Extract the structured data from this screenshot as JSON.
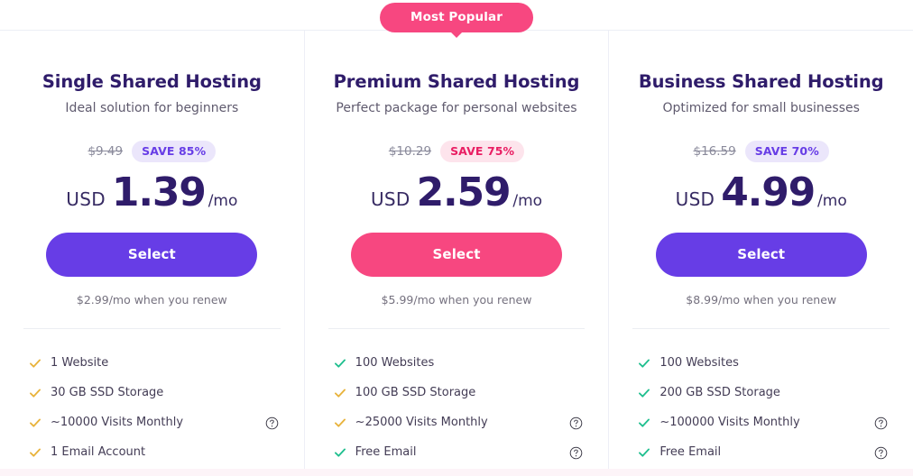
{
  "badge": {
    "most_popular": "Most Popular"
  },
  "colors": {
    "purple": "#673de6",
    "pink": "#f74780",
    "heading": "#2f1c6a",
    "check_green": "#20bf8f",
    "check_amber": "#e8b33c"
  },
  "plans": [
    {
      "id": "single-shared-hosting",
      "title": "Single Shared Hosting",
      "subtitle": "Ideal solution for beginners",
      "old_price": "$9.49",
      "save_label": "SAVE 85%",
      "save_style": "purple",
      "currency": "USD",
      "amount": "1.39",
      "period": "/mo",
      "select_label": "Select",
      "button_style": "purple",
      "renew_note": "$2.99/mo when you renew",
      "popular": false,
      "features": [
        {
          "label": "1 Website",
          "check": "amber",
          "help": false
        },
        {
          "label": "30 GB SSD Storage",
          "check": "amber",
          "help": false
        },
        {
          "label": "~10000 Visits Monthly",
          "check": "amber",
          "help": true
        },
        {
          "label": "1 Email Account",
          "check": "amber",
          "help": false
        }
      ]
    },
    {
      "id": "premium-shared-hosting",
      "title": "Premium Shared Hosting",
      "subtitle": "Perfect package for personal websites",
      "old_price": "$10.29",
      "save_label": "SAVE 75%",
      "save_style": "pink",
      "currency": "USD",
      "amount": "2.59",
      "period": "/mo",
      "select_label": "Select",
      "button_style": "pink",
      "renew_note": "$5.99/mo when you renew",
      "popular": true,
      "features": [
        {
          "label": "100 Websites",
          "check": "green",
          "help": false
        },
        {
          "label": "100 GB SSD Storage",
          "check": "amber",
          "help": false
        },
        {
          "label": "~25000 Visits Monthly",
          "check": "amber",
          "help": true
        },
        {
          "label": "Free Email",
          "check": "green",
          "help": true
        }
      ]
    },
    {
      "id": "business-shared-hosting",
      "title": "Business Shared Hosting",
      "subtitle": "Optimized for small businesses",
      "old_price": "$16.59",
      "save_label": "SAVE 70%",
      "save_style": "purple",
      "currency": "USD",
      "amount": "4.99",
      "period": "/mo",
      "select_label": "Select",
      "button_style": "purple",
      "renew_note": "$8.99/mo when you renew",
      "popular": false,
      "features": [
        {
          "label": "100 Websites",
          "check": "green",
          "help": false
        },
        {
          "label": "200 GB SSD Storage",
          "check": "green",
          "help": false
        },
        {
          "label": "~100000 Visits Monthly",
          "check": "green",
          "help": true
        },
        {
          "label": "Free Email",
          "check": "green",
          "help": true
        }
      ]
    }
  ],
  "icons": {
    "check": "check-icon",
    "help": "help-circle-icon"
  }
}
